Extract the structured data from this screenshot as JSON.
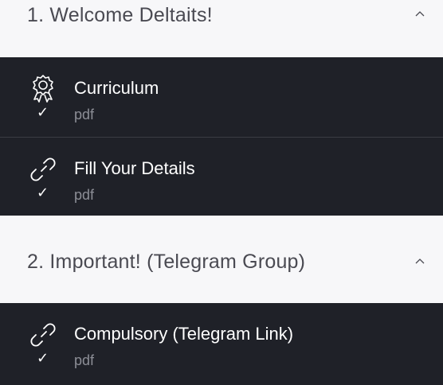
{
  "sections": [
    {
      "title": "1. Welcome Deltaits!",
      "lessons": [
        {
          "title": "Curriculum",
          "type": "pdf",
          "icon": "award-badge-icon",
          "completed": true
        },
        {
          "title": "Fill Your Details",
          "type": "pdf",
          "icon": "link-icon",
          "completed": true
        }
      ]
    },
    {
      "title": "2. Important! (Telegram Group)",
      "lessons": [
        {
          "title": "Compulsory (Telegram Link)",
          "type": "pdf",
          "icon": "link-icon",
          "completed": true
        }
      ]
    }
  ],
  "check_glyph": "✓",
  "colors": {
    "header_bg": "#f7f7f9",
    "lesson_bg": "#1f2128",
    "lesson_title": "#ffffff",
    "lesson_type": "#8c8e96",
    "section_title": "#4a4a52"
  }
}
